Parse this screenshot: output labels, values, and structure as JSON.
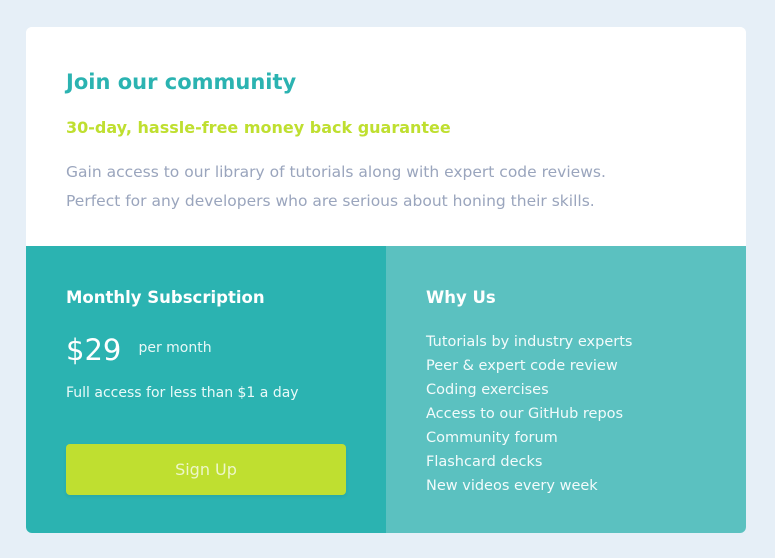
{
  "header": {
    "title": "Join our community",
    "guarantee": "30-day, hassle-free money back guarantee",
    "description_lines": [
      "Gain access to our library of tutorials along with expert code reviews.",
      "Perfect for any developers who are serious about honing their skills."
    ]
  },
  "subscription": {
    "title": "Monthly Subscription",
    "price": "$29",
    "period": "per month",
    "note": "Full access for less than $1 a day",
    "signup_label": "Sign Up"
  },
  "why_us": {
    "title": "Why Us",
    "items": [
      "Tutorials by industry experts",
      "Peer & expert code review",
      "Coding exercises",
      "Access to our GitHub repos",
      "Community forum",
      "Flashcard decks",
      "New videos every week"
    ]
  },
  "colors": {
    "page_background": "#e6eff7",
    "card_background": "#ffffff",
    "primary_teal": "#2bb3b1",
    "light_teal": "#5bc1c0",
    "lime_accent": "#bfdf30",
    "description_gray": "#9aa5bd"
  }
}
